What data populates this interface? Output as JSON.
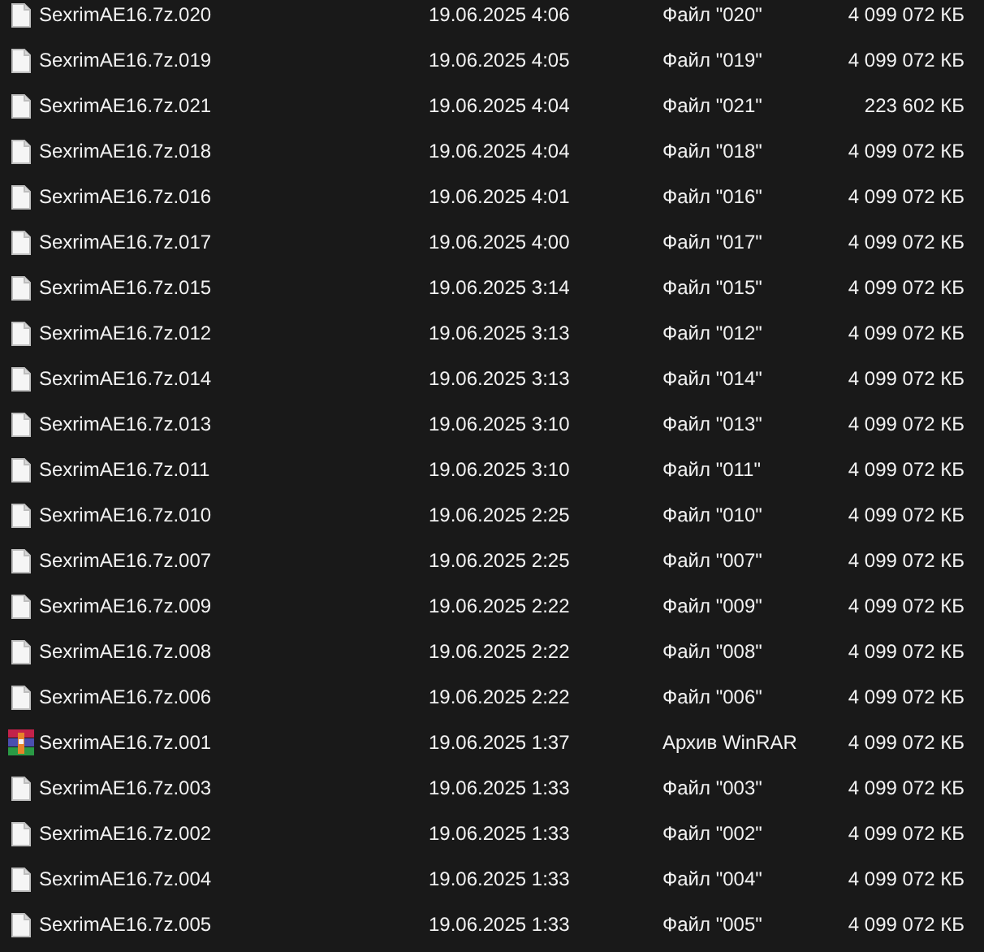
{
  "files": [
    {
      "kind": "file",
      "name": "SexrimAE16.7z.020",
      "date": "19.06.2025 4:06",
      "type": "Файл \"020\"",
      "size": "4 099 072 КБ"
    },
    {
      "kind": "file",
      "name": "SexrimAE16.7z.019",
      "date": "19.06.2025 4:05",
      "type": "Файл \"019\"",
      "size": "4 099 072 КБ"
    },
    {
      "kind": "file",
      "name": "SexrimAE16.7z.021",
      "date": "19.06.2025 4:04",
      "type": "Файл \"021\"",
      "size": "223 602 КБ"
    },
    {
      "kind": "file",
      "name": "SexrimAE16.7z.018",
      "date": "19.06.2025 4:04",
      "type": "Файл \"018\"",
      "size": "4 099 072 КБ"
    },
    {
      "kind": "file",
      "name": "SexrimAE16.7z.016",
      "date": "19.06.2025 4:01",
      "type": "Файл \"016\"",
      "size": "4 099 072 КБ"
    },
    {
      "kind": "file",
      "name": "SexrimAE16.7z.017",
      "date": "19.06.2025 4:00",
      "type": "Файл \"017\"",
      "size": "4 099 072 КБ"
    },
    {
      "kind": "file",
      "name": "SexrimAE16.7z.015",
      "date": "19.06.2025 3:14",
      "type": "Файл \"015\"",
      "size": "4 099 072 КБ"
    },
    {
      "kind": "file",
      "name": "SexrimAE16.7z.012",
      "date": "19.06.2025 3:13",
      "type": "Файл \"012\"",
      "size": "4 099 072 КБ"
    },
    {
      "kind": "file",
      "name": "SexrimAE16.7z.014",
      "date": "19.06.2025 3:13",
      "type": "Файл \"014\"",
      "size": "4 099 072 КБ"
    },
    {
      "kind": "file",
      "name": "SexrimAE16.7z.013",
      "date": "19.06.2025 3:10",
      "type": "Файл \"013\"",
      "size": "4 099 072 КБ"
    },
    {
      "kind": "file",
      "name": "SexrimAE16.7z.011",
      "date": "19.06.2025 3:10",
      "type": "Файл \"011\"",
      "size": "4 099 072 КБ"
    },
    {
      "kind": "file",
      "name": "SexrimAE16.7z.010",
      "date": "19.06.2025 2:25",
      "type": "Файл \"010\"",
      "size": "4 099 072 КБ"
    },
    {
      "kind": "file",
      "name": "SexrimAE16.7z.007",
      "date": "19.06.2025 2:25",
      "type": "Файл \"007\"",
      "size": "4 099 072 КБ"
    },
    {
      "kind": "file",
      "name": "SexrimAE16.7z.009",
      "date": "19.06.2025 2:22",
      "type": "Файл \"009\"",
      "size": "4 099 072 КБ"
    },
    {
      "kind": "file",
      "name": "SexrimAE16.7z.008",
      "date": "19.06.2025 2:22",
      "type": "Файл \"008\"",
      "size": "4 099 072 КБ"
    },
    {
      "kind": "file",
      "name": "SexrimAE16.7z.006",
      "date": "19.06.2025 2:22",
      "type": "Файл \"006\"",
      "size": "4 099 072 КБ"
    },
    {
      "kind": "archive",
      "name": "SexrimAE16.7z.001",
      "date": "19.06.2025 1:37",
      "type": "Архив WinRAR",
      "size": "4 099 072 КБ"
    },
    {
      "kind": "file",
      "name": "SexrimAE16.7z.003",
      "date": "19.06.2025 1:33",
      "type": "Файл \"003\"",
      "size": "4 099 072 КБ"
    },
    {
      "kind": "file",
      "name": "SexrimAE16.7z.002",
      "date": "19.06.2025 1:33",
      "type": "Файл \"002\"",
      "size": "4 099 072 КБ"
    },
    {
      "kind": "file",
      "name": "SexrimAE16.7z.004",
      "date": "19.06.2025 1:33",
      "type": "Файл \"004\"",
      "size": "4 099 072 КБ"
    },
    {
      "kind": "file",
      "name": "SexrimAE16.7z.005",
      "date": "19.06.2025 1:33",
      "type": "Файл \"005\"",
      "size": "4 099 072 КБ"
    }
  ]
}
